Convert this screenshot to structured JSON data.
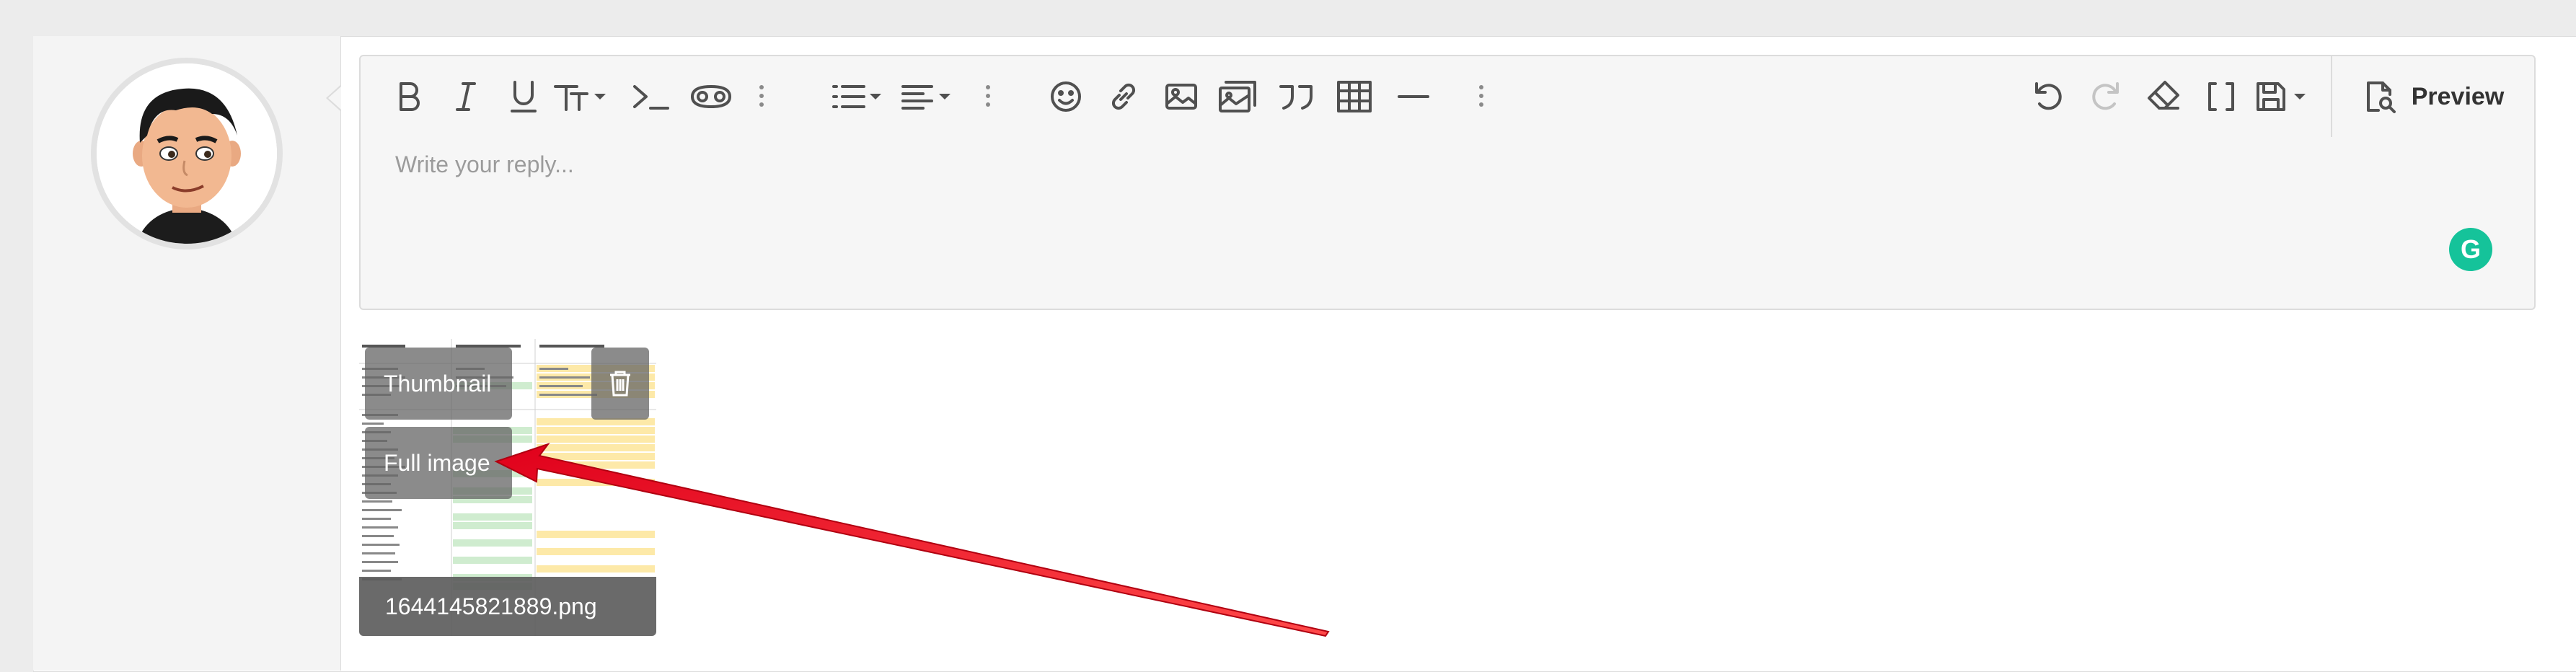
{
  "toolbar": {
    "buttons": [
      "bold",
      "italic",
      "underline",
      "text-size",
      "inline-code",
      "spoiler",
      "more-inline",
      "list",
      "align",
      "more-block",
      "smilies",
      "link",
      "image",
      "media",
      "quote",
      "table",
      "horizontal-rule",
      "more-insert",
      "undo",
      "redo",
      "remove-formatting",
      "bbcode-toggle",
      "drafts"
    ],
    "preview_label": "Preview"
  },
  "editor": {
    "placeholder": "Write your reply..."
  },
  "attachment": {
    "thumbnail_label": "Thumbnail",
    "full_image_label": "Full image",
    "filename": "1644145821889.png"
  },
  "colors": {
    "grammarly": "#15c39a",
    "annotation_arrow": "#e0001b"
  }
}
